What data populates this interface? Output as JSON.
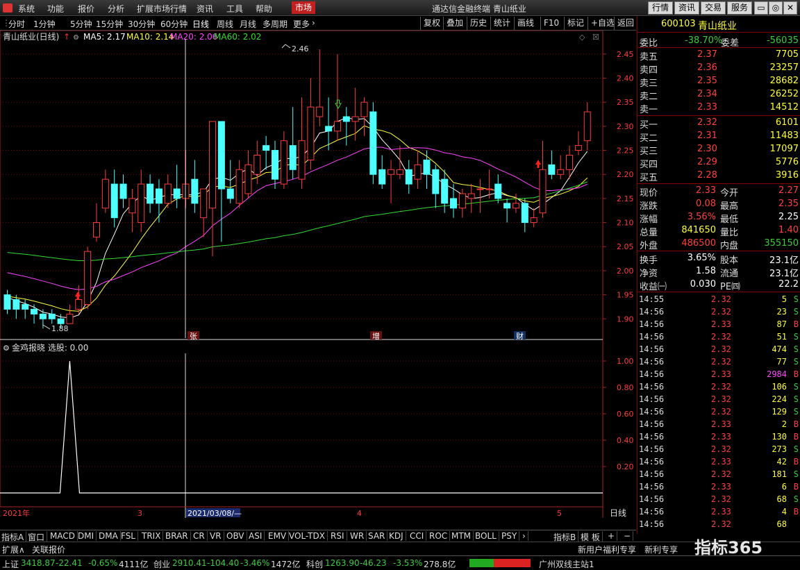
{
  "menu": {
    "items": [
      "系统",
      "功能",
      "报价",
      "分析",
      "扩展市场行情",
      "资讯",
      "工具",
      "帮助"
    ],
    "active": "市场",
    "title": "通达信金融终端 青山纸业",
    "right_buttons": [
      "行情",
      "资讯",
      "交易",
      "服务"
    ]
  },
  "toolbar": {
    "periods": [
      "分时",
      "1分钟",
      "5分钟",
      "15分钟",
      "30分钟",
      "60分钟",
      "日线",
      "周线",
      "月线",
      "多周期",
      "更多"
    ],
    "selected": "日线",
    "right_buttons": [
      "复权",
      "叠加",
      "历史",
      "统计",
      "画线",
      "F10",
      "标记",
      "+自选",
      "返回"
    ]
  },
  "main_chart": {
    "header_title": "青山纸业(日线)",
    "ma_legend": [
      {
        "label": "MA5: 2.17",
        "color": "#ffffff"
      },
      {
        "label": "MA10: 2.14",
        "color": "#ffff3c"
      },
      {
        "label": "MA20: 2.06",
        "color": "#ff44ff"
      },
      {
        "label": "MA60: 2.02",
        "color": "#33dd33"
      }
    ],
    "yaxis_ticks": [
      "2.45",
      "2.40",
      "2.35",
      "2.30",
      "2.25",
      "2.20",
      "2.15",
      "2.10",
      "2.05",
      "2.00",
      "1.95",
      "1.90"
    ],
    "high_label": "2.46",
    "low_label": "1.88",
    "event_markers": [
      "张",
      "增",
      "财"
    ]
  },
  "indicator_chart": {
    "header": "金鸡报晓 选股: 0.00",
    "yaxis_ticks": [
      "1.00",
      "0.80",
      "0.60",
      "0.40",
      "0.20"
    ]
  },
  "xaxis": {
    "labels": [
      "2021年",
      "3",
      "2021/03/08/—",
      "4",
      "5"
    ],
    "period_label": "日线"
  },
  "quote": {
    "code": "600103",
    "name": "青山纸业",
    "weibi_label": "委比",
    "weibi": "-38.70%",
    "weicha_label": "委差",
    "weicha": "-56035",
    "asks": [
      {
        "label": "卖五",
        "price": "2.37",
        "vol": "7705"
      },
      {
        "label": "卖四",
        "price": "2.36",
        "vol": "23257"
      },
      {
        "label": "卖三",
        "price": "2.35",
        "vol": "28682"
      },
      {
        "label": "卖二",
        "price": "2.34",
        "vol": "26252"
      },
      {
        "label": "卖一",
        "price": "2.33",
        "vol": "14512"
      }
    ],
    "bids": [
      {
        "label": "买一",
        "price": "2.32",
        "vol": "6101"
      },
      {
        "label": "买二",
        "price": "2.31",
        "vol": "11483"
      },
      {
        "label": "买三",
        "price": "2.30",
        "vol": "17097"
      },
      {
        "label": "买四",
        "price": "2.29",
        "vol": "5776"
      },
      {
        "label": "买五",
        "price": "2.28",
        "vol": "3916"
      }
    ],
    "stats": [
      {
        "l1": "现价",
        "v1": "2.33",
        "c1": "red",
        "l2": "今开",
        "v2": "2.27",
        "c2": "red"
      },
      {
        "l1": "涨跌",
        "v1": "0.08",
        "c1": "red",
        "l2": "最高",
        "v2": "2.35",
        "c2": "red"
      },
      {
        "l1": "涨幅",
        "v1": "3.56%",
        "c1": "red",
        "l2": "最低",
        "v2": "2.25",
        "c2": "white"
      },
      {
        "l1": "总量",
        "v1": "841650",
        "c1": "yellow",
        "l2": "量比",
        "v2": "1.40",
        "c2": "red"
      },
      {
        "l1": "外盘",
        "v1": "486500",
        "c1": "red",
        "l2": "内盘",
        "v2": "355150",
        "c2": "green"
      }
    ],
    "stats2": [
      {
        "l1": "换手",
        "v1": "3.65%",
        "l2": "股本",
        "v2": "23.1亿"
      },
      {
        "l1": "净资",
        "v1": "1.58",
        "l2": "流通",
        "v2": "23.1亿"
      },
      {
        "l1": "收益㈠",
        "v1": "0.030",
        "l2": "PE㈣",
        "v2": "22.2"
      }
    ]
  },
  "ticks": [
    {
      "t": "14:55",
      "p": "2.32",
      "v": "5",
      "bs": "S"
    },
    {
      "t": "14:56",
      "p": "2.32",
      "v": "23",
      "bs": "S"
    },
    {
      "t": "14:56",
      "p": "2.33",
      "v": "87",
      "bs": "B"
    },
    {
      "t": "14:56",
      "p": "2.32",
      "v": "51",
      "bs": "S"
    },
    {
      "t": "14:56",
      "p": "2.32",
      "v": "474",
      "bs": "S"
    },
    {
      "t": "14:56",
      "p": "2.32",
      "v": "77",
      "bs": "S"
    },
    {
      "t": "14:56",
      "p": "2.33",
      "v": "2984",
      "bs": "B"
    },
    {
      "t": "14:56",
      "p": "2.32",
      "v": "106",
      "bs": "S"
    },
    {
      "t": "14:56",
      "p": "2.32",
      "v": "224",
      "bs": "S"
    },
    {
      "t": "14:56",
      "p": "2.32",
      "v": "129",
      "bs": "S"
    },
    {
      "t": "14:56",
      "p": "2.33",
      "v": "2",
      "bs": "B"
    },
    {
      "t": "14:56",
      "p": "2.33",
      "v": "130",
      "bs": "B"
    },
    {
      "t": "14:56",
      "p": "2.32",
      "v": "273",
      "bs": "S"
    },
    {
      "t": "14:56",
      "p": "2.33",
      "v": "42",
      "bs": "B"
    },
    {
      "t": "14:56",
      "p": "2.32",
      "v": "181",
      "bs": "S"
    },
    {
      "t": "14:56",
      "p": "2.33",
      "v": "6",
      "bs": "B"
    },
    {
      "t": "14:56",
      "p": "2.32",
      "v": "68",
      "bs": "S"
    },
    {
      "t": "14:56",
      "p": "2.33",
      "v": "4",
      "bs": "B"
    },
    {
      "t": "14:56",
      "p": "2.32",
      "v": "68",
      "bs": ""
    }
  ],
  "indicator_tabs": [
    "指标A",
    "窗口",
    "MACD",
    "DMI",
    "DMA",
    "FSL",
    "TRIX",
    "BRAR",
    "CR",
    "VR",
    "OBV",
    "ASI",
    "EMV",
    "VOL-TDX",
    "RSI",
    "WR",
    "SAR",
    "KDJ",
    "CCI",
    "ROC",
    "MTM",
    "BOLL",
    "PSY"
  ],
  "indicator_right": [
    "指标B",
    "模 板",
    "+",
    "−"
  ],
  "ext_bar": {
    "left": "扩展∧",
    "right": "关联报价",
    "promo1": "新用户福利专享",
    "promo2": "新利专享",
    "watermark": "指标365"
  },
  "status": {
    "sh_label": "上证",
    "sh_val": "3418.87",
    "sh_chg": "-22.41",
    "sh_pct": "-0.65%",
    "sh_amt": "4111亿",
    "cy_label": "创业",
    "cy_val": "2910.41",
    "cy_chg": "-104.40",
    "cy_pct": "-3.46%",
    "cy_amt": "1472亿",
    "kc_label": "科创",
    "kc_val": "1263.90",
    "kc_chg": "-46.23",
    "kc_pct": "-3.53%",
    "kc_amt": "278.8亿",
    "server": "广州双线主站1"
  },
  "chart_data": {
    "type": "candlestick",
    "y_range": [
      1.86,
      2.47
    ],
    "candles": [
      [
        1.95,
        1.92,
        1.96,
        1.91
      ],
      [
        1.94,
        1.92,
        1.95,
        1.9
      ],
      [
        1.93,
        1.92,
        1.94,
        1.9
      ],
      [
        1.92,
        1.91,
        1.93,
        1.89
      ],
      [
        1.91,
        1.9,
        1.92,
        1.88
      ],
      [
        1.91,
        1.9,
        1.92,
        1.89
      ],
      [
        1.9,
        1.89,
        1.91,
        1.88
      ],
      [
        1.89,
        1.91,
        1.93,
        1.89
      ],
      [
        1.92,
        1.94,
        1.97,
        1.91
      ],
      [
        1.93,
        2.04,
        2.05,
        1.92
      ],
      [
        2.07,
        2.1,
        2.14,
        2.06
      ],
      [
        2.13,
        2.19,
        2.21,
        2.12
      ],
      [
        2.18,
        2.11,
        2.21,
        2.09
      ],
      [
        2.18,
        2.15,
        2.2,
        2.13
      ],
      [
        2.12,
        2.15,
        2.17,
        2.08
      ],
      [
        2.1,
        2.18,
        2.21,
        2.08
      ],
      [
        2.18,
        2.14,
        2.2,
        2.12
      ],
      [
        2.17,
        2.14,
        2.19,
        2.1
      ],
      [
        2.14,
        2.18,
        2.2,
        2.13
      ],
      [
        2.17,
        2.15,
        2.22,
        2.13
      ],
      [
        2.15,
        2.18,
        2.25,
        2.13
      ],
      [
        2.19,
        2.14,
        2.23,
        2.12
      ],
      [
        2.11,
        2.17,
        2.17,
        2.07
      ],
      [
        2.13,
        2.31,
        2.31,
        2.03
      ],
      [
        2.31,
        2.17,
        2.31,
        2.06
      ],
      [
        2.17,
        2.15,
        2.23,
        2.14
      ],
      [
        2.14,
        2.21,
        2.23,
        2.13
      ],
      [
        2.16,
        2.22,
        2.25,
        2.15
      ],
      [
        2.2,
        2.24,
        2.27,
        2.18
      ],
      [
        2.26,
        2.25,
        2.28,
        2.21
      ],
      [
        2.25,
        2.19,
        2.27,
        2.17
      ],
      [
        2.18,
        2.27,
        2.29,
        2.17
      ],
      [
        2.26,
        2.21,
        2.34,
        2.19
      ],
      [
        2.19,
        2.27,
        2.36,
        2.17
      ],
      [
        2.23,
        2.34,
        2.4,
        2.21
      ],
      [
        2.32,
        2.34,
        2.46,
        2.3
      ],
      [
        2.3,
        2.29,
        2.36,
        2.25
      ],
      [
        2.29,
        2.31,
        2.45,
        2.27
      ],
      [
        2.32,
        2.31,
        2.34,
        2.26
      ],
      [
        2.31,
        2.32,
        2.38,
        2.27
      ],
      [
        2.32,
        2.35,
        2.36,
        2.28
      ],
      [
        2.33,
        2.2,
        2.35,
        2.18
      ],
      [
        2.21,
        2.18,
        2.24,
        2.17
      ],
      [
        2.2,
        2.21,
        2.23,
        2.14
      ],
      [
        2.2,
        2.21,
        2.26,
        2.19
      ],
      [
        2.21,
        2.18,
        2.23,
        2.16
      ],
      [
        2.19,
        2.22,
        2.25,
        2.17
      ],
      [
        2.23,
        2.2,
        2.25,
        2.17
      ],
      [
        2.21,
        2.16,
        2.22,
        2.13
      ],
      [
        2.19,
        2.14,
        2.21,
        2.12
      ],
      [
        2.15,
        2.13,
        2.18,
        2.11
      ],
      [
        2.13,
        2.16,
        2.17,
        2.11
      ],
      [
        2.15,
        2.16,
        2.18,
        2.12
      ],
      [
        2.17,
        2.17,
        2.19,
        2.12
      ],
      [
        2.17,
        2.17,
        2.21,
        2.15
      ],
      [
        2.18,
        2.15,
        2.2,
        2.14
      ],
      [
        2.14,
        2.13,
        2.15,
        2.1
      ],
      [
        2.13,
        2.14,
        2.16,
        2.12
      ],
      [
        2.14,
        2.1,
        2.15,
        2.08
      ],
      [
        2.1,
        2.11,
        2.13,
        2.09
      ],
      [
        2.12,
        2.21,
        2.27,
        2.11
      ],
      [
        2.22,
        2.2,
        2.25,
        2.19
      ],
      [
        2.2,
        2.21,
        2.24,
        2.19
      ],
      [
        2.21,
        2.24,
        2.26,
        2.19
      ],
      [
        2.25,
        2.26,
        2.29,
        2.24
      ],
      [
        2.27,
        2.33,
        2.35,
        2.25
      ]
    ],
    "signal_peak_index": 7
  },
  "colors": {
    "up": "#ff3c3c",
    "down": "#4dffff",
    "grid": "#a01010",
    "frame": "#aa2020"
  }
}
